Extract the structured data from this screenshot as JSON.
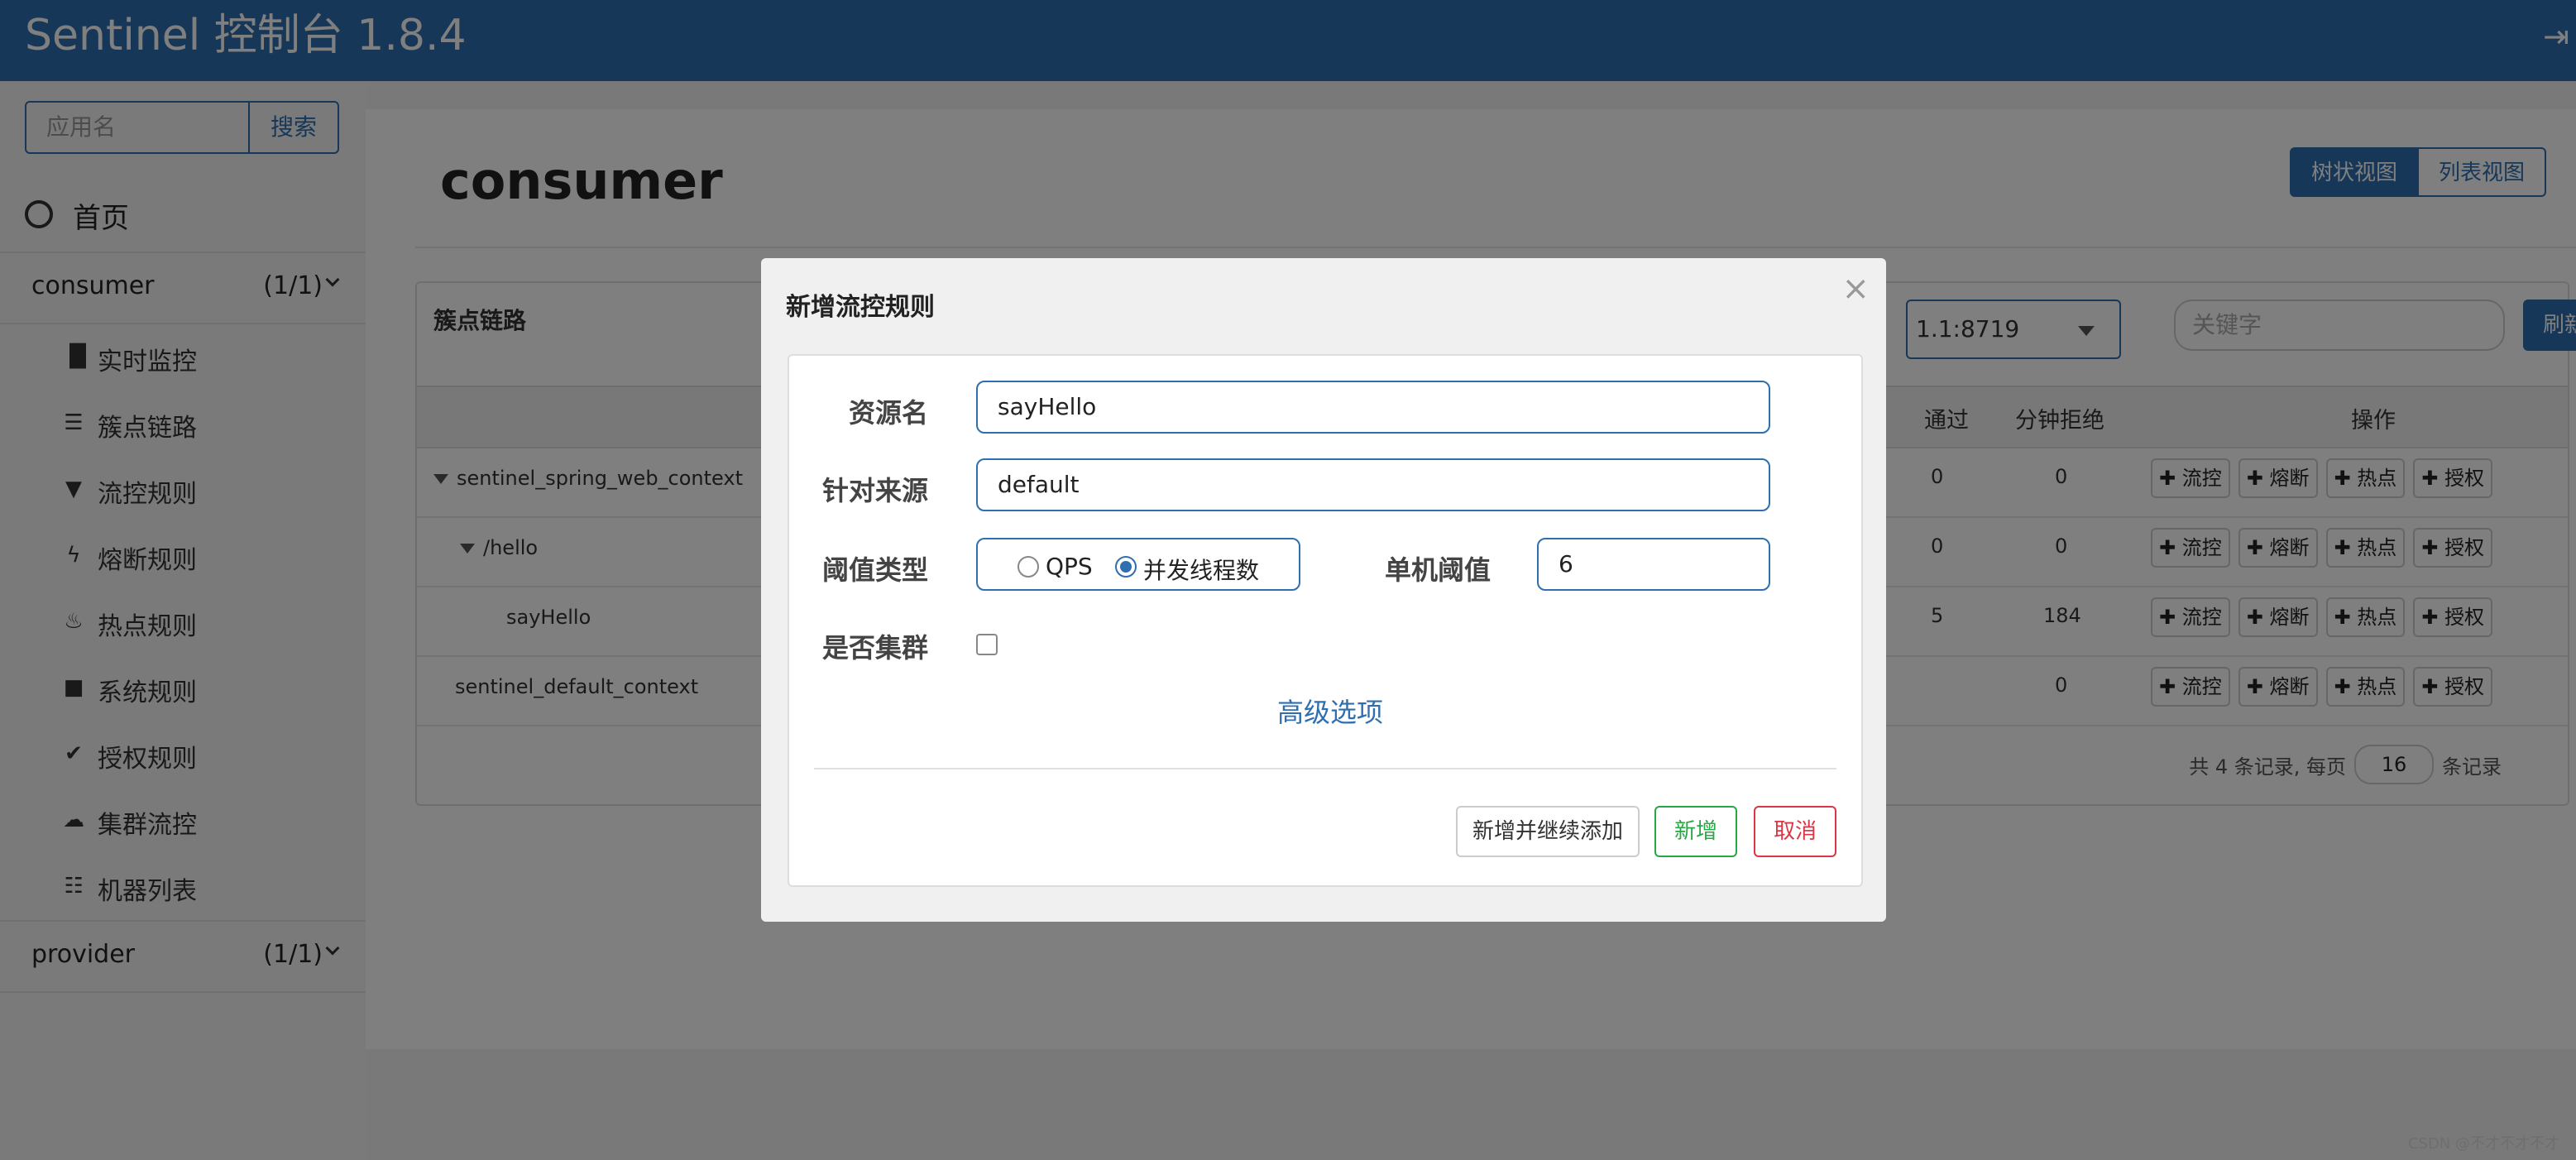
{
  "header": {
    "title": "Sentinel 控制台 1.8.4",
    "logout_icon": "sign-out-icon"
  },
  "sidebar": {
    "search_placeholder": "应用名",
    "search_button": "搜索",
    "home_label": "首页",
    "apps": [
      {
        "name": "consumer",
        "count": "(1/1)"
      },
      {
        "name": "provider",
        "count": "(1/1)"
      }
    ],
    "items": [
      {
        "label": "实时监控",
        "icon": "bar-chart-icon",
        "glyph": "▐▌"
      },
      {
        "label": "簇点链路",
        "icon": "list-alt-icon",
        "glyph": "☰"
      },
      {
        "label": "流控规则",
        "icon": "filter-icon",
        "glyph": "▼"
      },
      {
        "label": "熔断规则",
        "icon": "flash-icon",
        "glyph": "ϟ"
      },
      {
        "label": "热点规则",
        "icon": "fire-icon",
        "glyph": "♨"
      },
      {
        "label": "系统规则",
        "icon": "lock-icon",
        "glyph": "■"
      },
      {
        "label": "授权规则",
        "icon": "check-icon",
        "glyph": "✔"
      },
      {
        "label": "集群流控",
        "icon": "cloud-icon",
        "glyph": "☁"
      },
      {
        "label": "机器列表",
        "icon": "th-list-icon",
        "glyph": "☷"
      }
    ]
  },
  "main": {
    "title": "consumer",
    "view_tree": "树状视图",
    "view_list": "列表视图",
    "panel_title": "簇点链路",
    "machine_value": "1.1:8719",
    "keyword_placeholder": "关键字",
    "refresh": "刷新",
    "columns": {
      "pass": "通过",
      "block": "分钟拒绝",
      "ops": "操作"
    },
    "rows": [
      {
        "resource": "sentinel_spring_web_context",
        "pass": "0",
        "block": "0",
        "expand": true,
        "indent": 0
      },
      {
        "resource": "/hello",
        "pass": "0",
        "block": "0",
        "expand": true,
        "indent": 1
      },
      {
        "resource": "sayHello",
        "pass": "5",
        "block": "184",
        "expand": false,
        "indent": 2
      },
      {
        "resource": "sentinel_default_context",
        "pass": "",
        "block": "0",
        "expand": false,
        "indent": 0
      }
    ],
    "op_buttons": [
      "✚ 流控",
      "✚ 熔断",
      "✚ 热点",
      "✚ 授权"
    ],
    "pager": {
      "prefix": "共 4 条记录, 每页",
      "per_page": "16",
      "suffix": "条记录"
    }
  },
  "modal": {
    "title": "新增流控规则",
    "close": "×",
    "resource_label": "资源名",
    "resource_value": "sayHello",
    "origin_label": "针对来源",
    "origin_value": "default",
    "grade_label": "阈值类型",
    "grade_options": [
      "QPS",
      "并发线程数"
    ],
    "grade_selected": "并发线程数",
    "threshold_label": "单机阈值",
    "threshold_value": "6",
    "cluster_label": "是否集群",
    "cluster_checked": false,
    "advanced": "高级选项",
    "btn_add_continue": "新增并继续添加",
    "btn_add": "新增",
    "btn_cancel": "取消"
  },
  "watermark": "CSDN @不才不才不才"
}
